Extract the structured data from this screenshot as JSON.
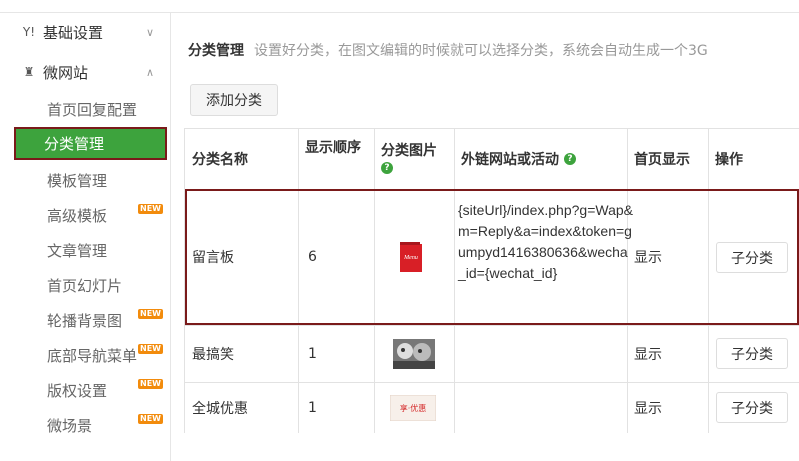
{
  "sidebar": {
    "section1": {
      "label": "基础设置",
      "icon": "settings-icon",
      "chevron": "chevron-down"
    },
    "section2": {
      "label": "微网站",
      "icon": "home-icon",
      "chevron": "chevron-up"
    },
    "items": [
      {
        "label": "首页回复配置",
        "badge": ""
      },
      {
        "label": "分类管理",
        "badge": "",
        "active": true
      },
      {
        "label": "模板管理",
        "badge": ""
      },
      {
        "label": "高级模板",
        "badge": "NEW"
      },
      {
        "label": "文章管理",
        "badge": ""
      },
      {
        "label": "首页幻灯片",
        "badge": ""
      },
      {
        "label": "轮播背景图",
        "badge": "NEW"
      },
      {
        "label": "底部导航菜单",
        "badge": "NEW"
      },
      {
        "label": "版权设置",
        "badge": "NEW"
      },
      {
        "label": "微场景",
        "badge": "NEW"
      }
    ]
  },
  "header": {
    "title": "分类管理",
    "description": "设置好分类，在图文编辑的时候就可以选择分类，系统会自动生成一个3G"
  },
  "toolbar": {
    "add_label": "添加分类"
  },
  "table": {
    "columns": {
      "name": "分类名称",
      "order": "显示顺序",
      "image": "分类图片",
      "link": "外链网站或活动",
      "home": "首页显示",
      "action": "操作"
    },
    "help_glyph": "?",
    "rows": [
      {
        "name": "留言板",
        "order": "6",
        "image": "Menu",
        "link": "{siteUrl}/index.php?g=Wap&m=Reply&a=index&token=gumpyd1416380636&wecha_id={wechat_id}",
        "home": "显示",
        "action": "子分类"
      },
      {
        "name": "最搞笑",
        "order": "1",
        "image": "",
        "link": "",
        "home": "显示",
        "action": "子分类"
      },
      {
        "name": "全城优惠",
        "order": "1",
        "image": "享·优惠",
        "link": "",
        "home": "显示",
        "action": "子分类"
      }
    ]
  },
  "colors": {
    "accent_green": "#3da33d",
    "highlight_border": "#7a1a1a",
    "badge_orange": "#f28b0c"
  }
}
